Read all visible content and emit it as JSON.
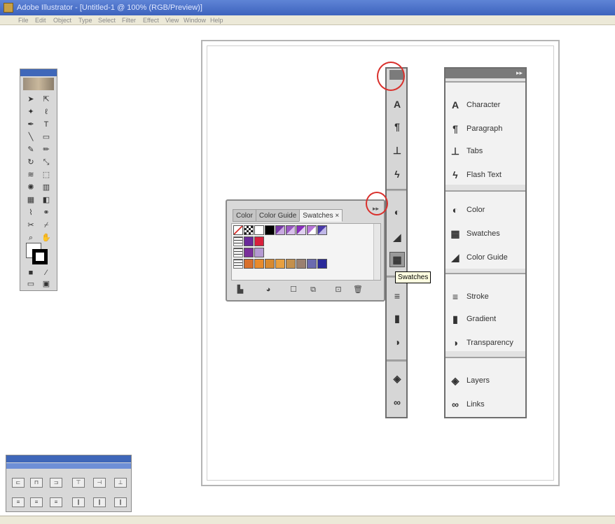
{
  "window": {
    "title": "Adobe Illustrator - [Untitled-1 @ 100% (RGB/Preview)]",
    "menu": [
      "File",
      "Edit",
      "Object",
      "Type",
      "Select",
      "Filter",
      "Effect",
      "View",
      "Window",
      "Help"
    ]
  },
  "dock": {
    "collapse_glyph": "▸▸",
    "groups": [
      {
        "items": [
          {
            "icon": "character-icon",
            "glyph": "A",
            "label": "Character"
          },
          {
            "icon": "paragraph-icon",
            "glyph": "¶",
            "label": "Paragraph"
          },
          {
            "icon": "tabs-icon",
            "glyph": "⊥",
            "label": "Tabs"
          },
          {
            "icon": "flash-text-icon",
            "glyph": "ϟ",
            "label": "Flash Text"
          }
        ]
      },
      {
        "items": [
          {
            "icon": "color-icon",
            "glyph": "◐",
            "label": "Color"
          },
          {
            "icon": "swatches-icon",
            "glyph": "▦",
            "label": "Swatches"
          },
          {
            "icon": "color-guide-icon",
            "glyph": "◢",
            "label": "Color Guide"
          }
        ]
      },
      {
        "items": [
          {
            "icon": "stroke-icon",
            "glyph": "≡",
            "label": "Stroke"
          },
          {
            "icon": "gradient-icon",
            "glyph": "▮",
            "label": "Gradient"
          },
          {
            "icon": "transparency-icon",
            "glyph": "◑",
            "label": "Transparency"
          }
        ]
      },
      {
        "items": [
          {
            "icon": "layers-icon",
            "glyph": "◈",
            "label": "Layers"
          },
          {
            "icon": "links-icon",
            "glyph": "∞",
            "label": "Links"
          }
        ]
      }
    ]
  },
  "swatches_panel": {
    "tabs": [
      "Color",
      "Color Guide",
      "Swatches"
    ],
    "active_tab": "Swatches",
    "tab_close": "×",
    "collapse_glyph": "▸▸",
    "row1": [
      "#ffffff",
      "#ffffff",
      "#000000",
      "#7a3aa8",
      "#9a58c2",
      "#8a2fbd",
      "#b776d8",
      "#4a3aa8"
    ],
    "row2": [
      "#6a2a9a",
      "#d8203c"
    ],
    "row3": [
      "#7a2f9a",
      "#b59ad2"
    ],
    "row4": [
      "#d8702c",
      "#e88b2c",
      "#d88a30",
      "#e8a040",
      "#c4904c",
      "#9a8070",
      "#6a6ab0",
      "#2a2a9a"
    ],
    "footer_buttons": [
      "swatch-libraries-icon",
      "show-kinds-icon",
      "swatch-options-icon",
      "new-color-group-icon",
      "new-swatch-icon",
      "delete-swatch-icon"
    ]
  },
  "tooltip": "Swatches",
  "colors": {
    "annotation_ring": "#d9302c",
    "title_bar": "#3d63bd"
  }
}
